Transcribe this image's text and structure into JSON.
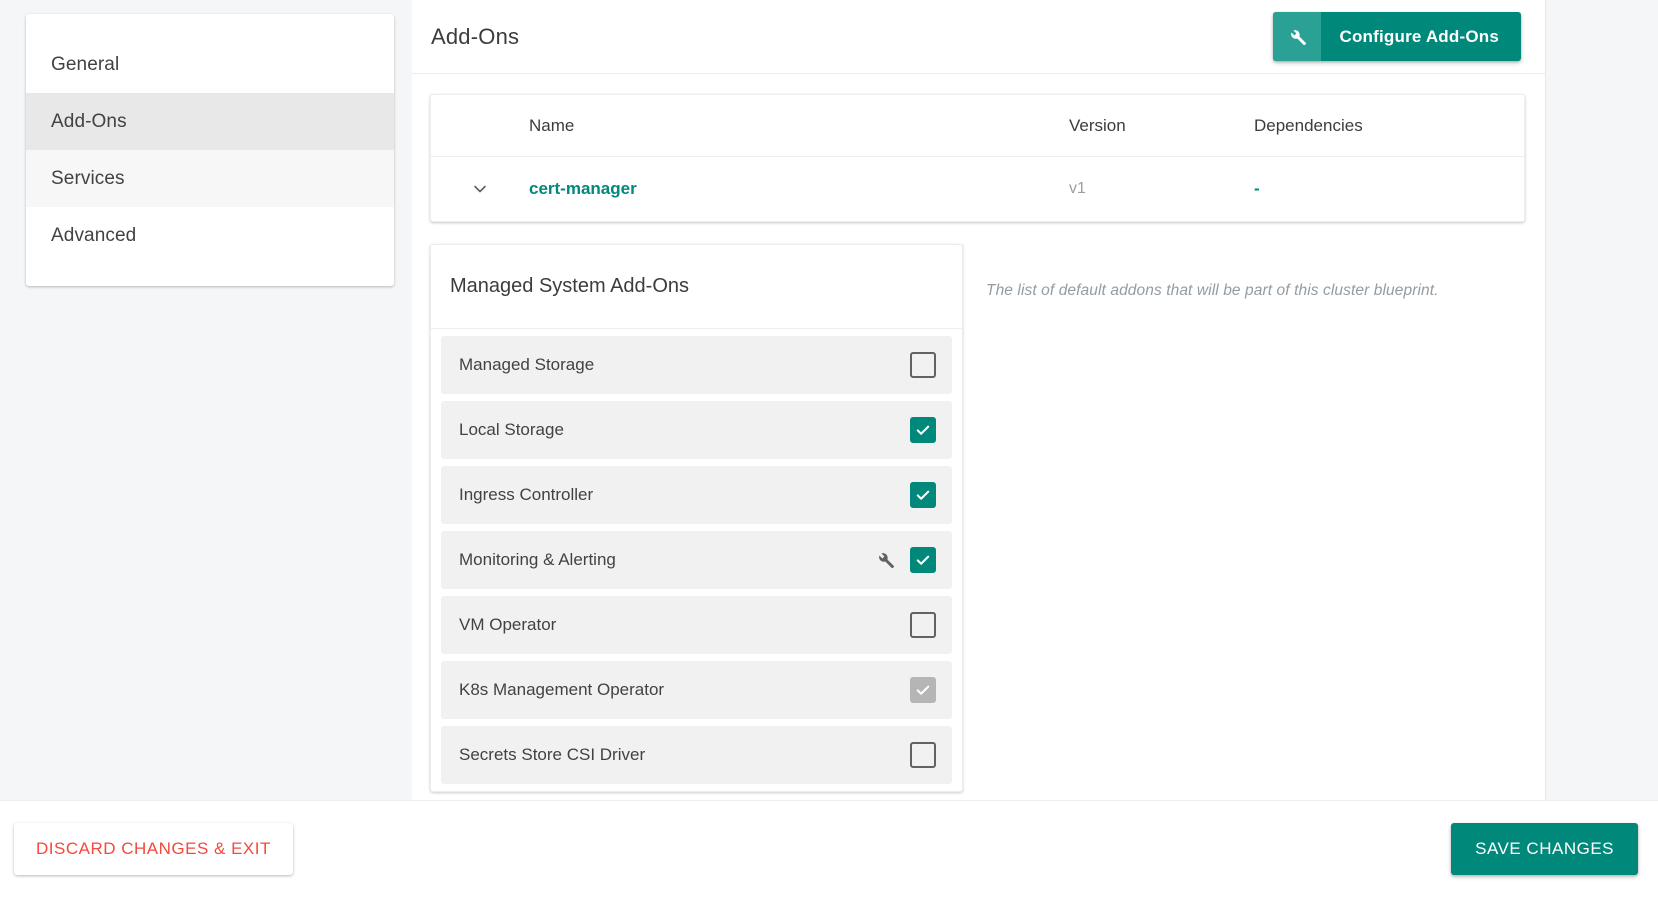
{
  "sidebar": {
    "items": [
      {
        "label": "General",
        "state": "normal"
      },
      {
        "label": "Add-Ons",
        "state": "selected"
      },
      {
        "label": "Services",
        "state": "tinted"
      },
      {
        "label": "Advanced",
        "state": "normal"
      }
    ]
  },
  "header": {
    "title": "Add-Ons",
    "configure_button": {
      "label": "Configure Add-Ons",
      "icon": "wrench-icon",
      "color": "#00897b",
      "icon_bg": "#2ba196"
    }
  },
  "addons_table": {
    "columns": [
      "Name",
      "Version",
      "Dependencies"
    ],
    "rows": [
      {
        "caret": "chevron-down-icon",
        "name": "cert-manager",
        "version": "v1",
        "dependencies": "-",
        "name_color": "#00897b",
        "version_color": "#9e9e9e",
        "dependencies_color": "#00897b"
      }
    ]
  },
  "managed_addons": {
    "title": "Managed System Add-Ons",
    "items": [
      {
        "label": "Managed Storage",
        "checked": false,
        "disabled": false,
        "has_wrench": false
      },
      {
        "label": "Local Storage",
        "checked": true,
        "disabled": false,
        "has_wrench": false
      },
      {
        "label": "Ingress Controller",
        "checked": true,
        "disabled": false,
        "has_wrench": false
      },
      {
        "label": "Monitoring & Alerting",
        "checked": true,
        "disabled": false,
        "has_wrench": true
      },
      {
        "label": "VM Operator",
        "checked": false,
        "disabled": false,
        "has_wrench": false
      },
      {
        "label": "K8s Management Operator",
        "checked": true,
        "disabled": true,
        "has_wrench": false
      },
      {
        "label": "Secrets Store CSI Driver",
        "checked": false,
        "disabled": false,
        "has_wrench": false
      }
    ]
  },
  "info": {
    "note": "The list of default addons that will be part of this cluster blueprint."
  },
  "footer": {
    "discard_label": "DISCARD CHANGES & EXIT",
    "save_label": "SAVE CHANGES",
    "discard_color": "#f4493c",
    "save_color": "#00897b"
  }
}
